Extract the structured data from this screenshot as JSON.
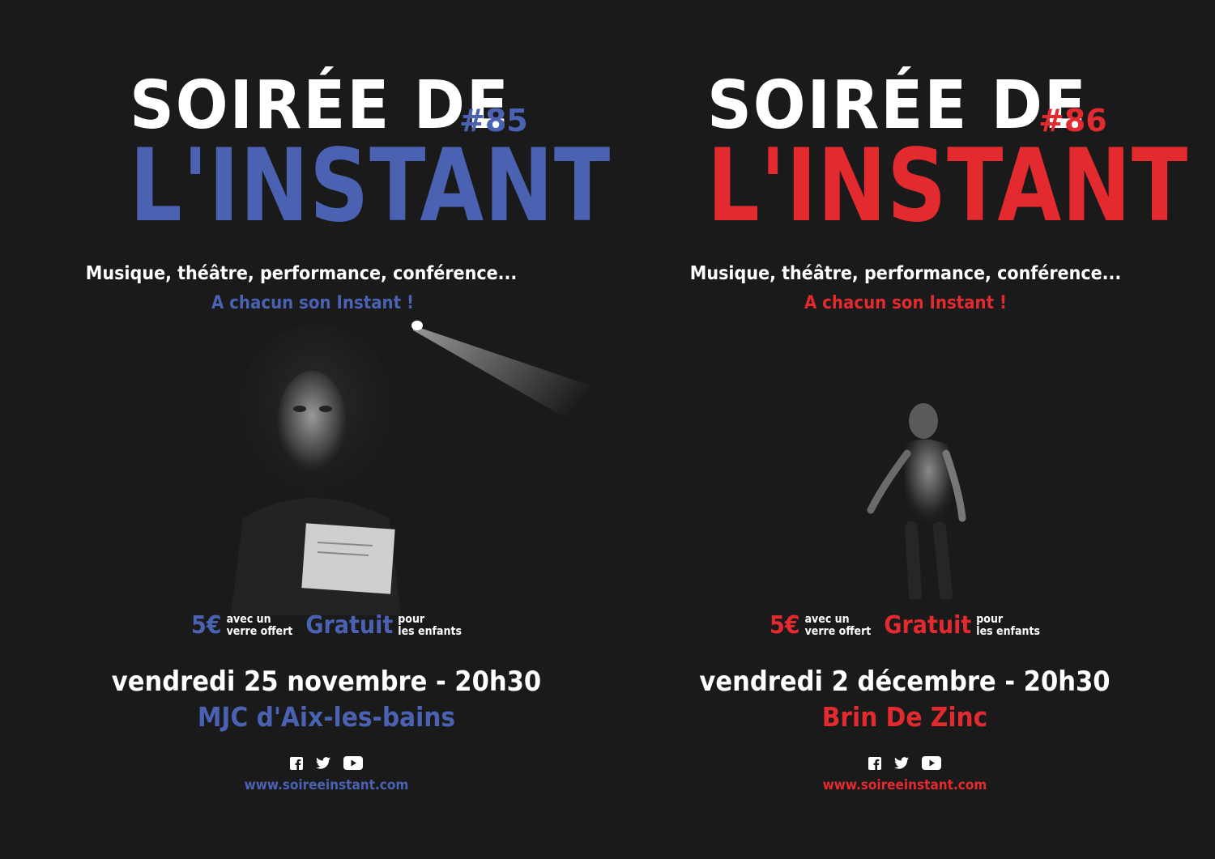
{
  "colors": {
    "background": "#1a1a1b",
    "text": "#ffffff",
    "blue": "#4a62b1",
    "red": "#e22a2f"
  },
  "posters": [
    {
      "accent": "#4a62b1",
      "title_line1": "SOIRÉE DE",
      "title_line2": "L'INSTANT",
      "issue": "#85",
      "tagline": "Musique, théâtre, performance, conférence...",
      "slogan": "A chacun son Instant !",
      "price_amount": "5€",
      "price_note_line1": "avec un",
      "price_note_line2": "verre offert",
      "free_label": "Gratuit",
      "free_note_line1": "pour",
      "free_note_line2": "les enfants",
      "date": "vendredi 25 novembre - 20h30",
      "venue": "MJC d'Aix-les-bains",
      "socials": [
        "facebook-icon",
        "twitter-icon",
        "youtube-icon"
      ],
      "website": "www.soireeinstant.com"
    },
    {
      "accent": "#e22a2f",
      "title_line1": "SOIRÉE DE",
      "title_line2": "L'INSTANT",
      "issue": "#86",
      "tagline": "Musique, théâtre, performance, conférence...",
      "slogan": "A chacun son Instant !",
      "price_amount": "5€",
      "price_note_line1": "avec un",
      "price_note_line2": "verre offert",
      "free_label": "Gratuit",
      "free_note_line1": "pour",
      "free_note_line2": "les enfants",
      "date": "vendredi 2 décembre - 20h30",
      "venue": "Brin De Zinc",
      "socials": [
        "facebook-icon",
        "twitter-icon",
        "youtube-icon"
      ],
      "website": "www.soireeinstant.com"
    }
  ]
}
